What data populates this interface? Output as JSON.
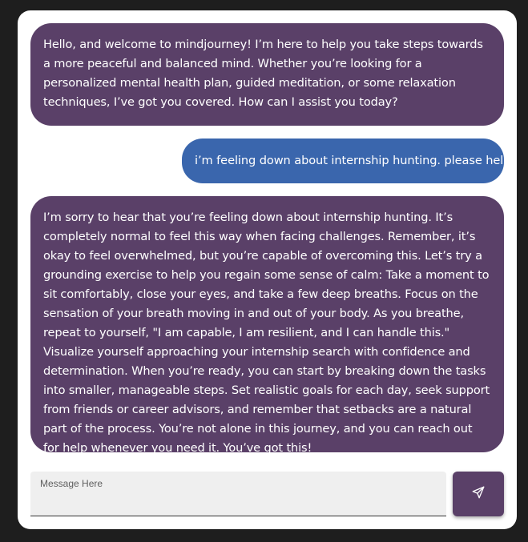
{
  "chat": {
    "messages": [
      {
        "role": "assistant",
        "text": "Hello, and welcome to mindjourney! I’m here to help you take steps towards a more peaceful and balanced mind. Whether you’re looking for a personalized mental health plan, guided meditation, or some relaxation techniques, I’ve got you covered. How can I assist you today?"
      },
      {
        "role": "user",
        "text": "i’m feeling down about internship hunting. please help"
      },
      {
        "role": "assistant",
        "text": "I’m sorry to hear that you’re feeling down about internship hunting. It’s completely normal to feel this way when facing challenges. Remember, it’s okay to feel overwhelmed, but you’re capable of overcoming this. Let’s try a grounding exercise to help you regain some sense of calm: Take a moment to sit comfortably, close your eyes, and take a few deep breaths. Focus on the sensation of your breath moving in and out of your body. As you breathe, repeat to yourself, \"I am capable, I am resilient, and I can handle this.\" Visualize yourself approaching your internship search with confidence and determination. When you’re ready, you can start by breaking down the tasks into smaller, manageable steps. Set realistic goals for each day, seek support from friends or career advisors, and remember that setbacks are a natural part of the process. You’re not alone in this journey, and you can reach out for help whenever you need it. You’ve got this!"
      }
    ]
  },
  "composer": {
    "label": "Message Here",
    "value": "",
    "send_icon": "send-icon"
  },
  "colors": {
    "assistant_bubble": "#5a4068",
    "user_bubble": "#3a66ad",
    "send_button": "#5a4068",
    "input_background": "#efefef",
    "page_background": "#1e1e1e"
  }
}
